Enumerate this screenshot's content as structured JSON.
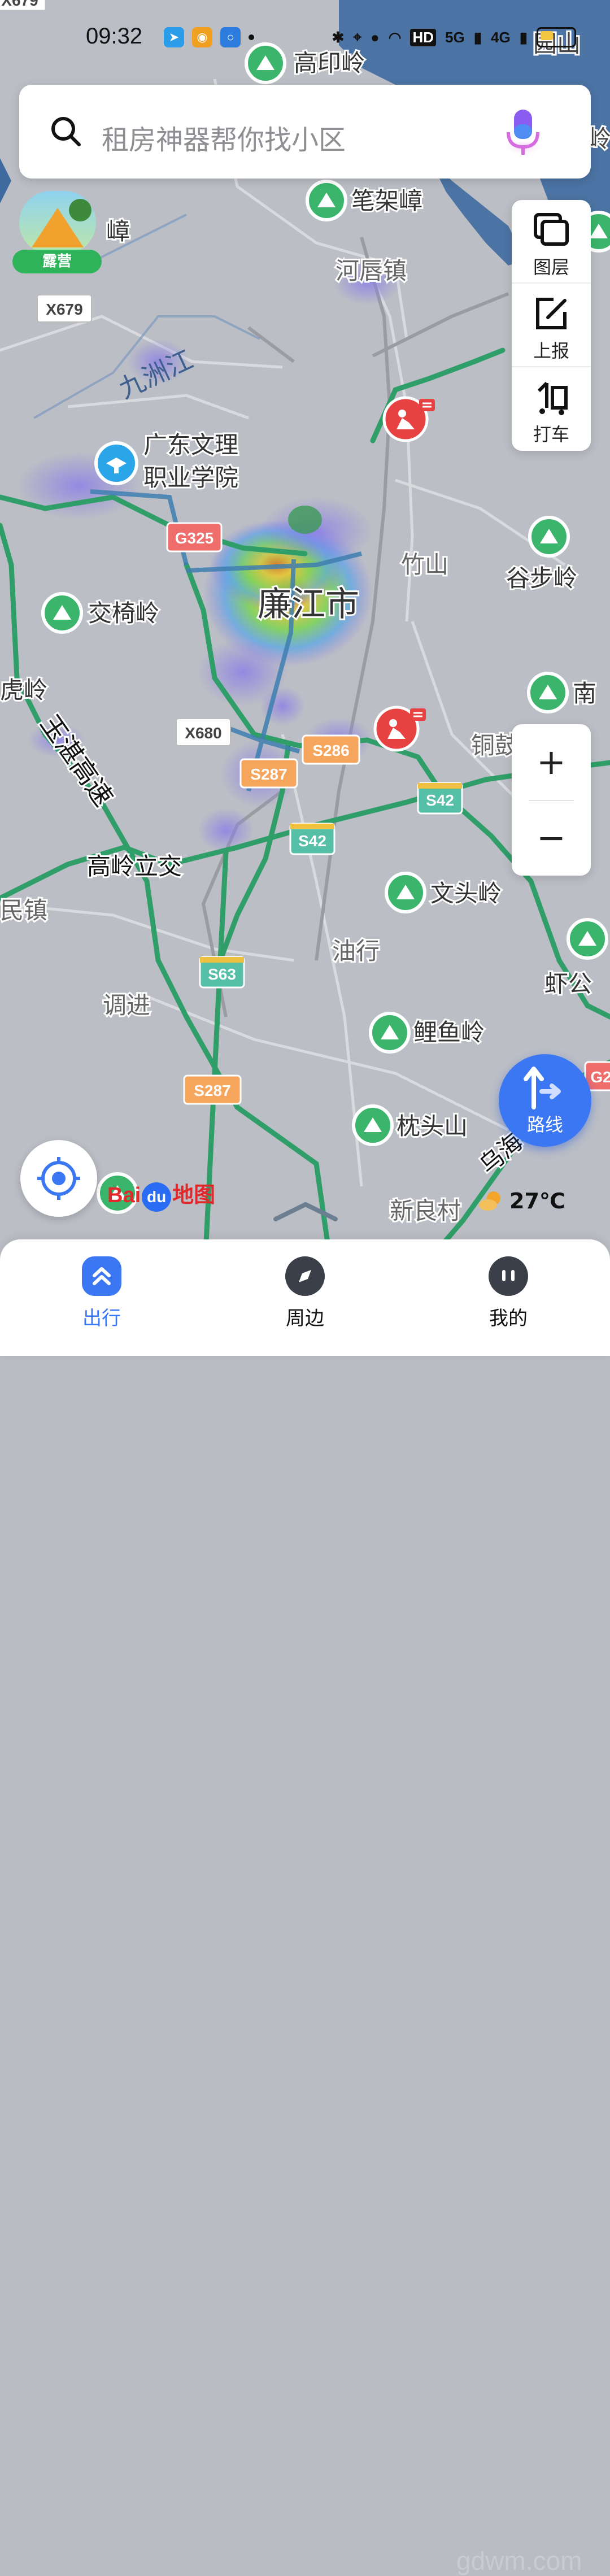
{
  "status_bar": {
    "time": "09:32",
    "hd": "HD",
    "net1": "5G",
    "net2": "4G"
  },
  "search": {
    "placeholder": "租房神器帮你找小区",
    "icon": "search-icon",
    "voice_icon": "microphone-icon"
  },
  "camp_badge": {
    "label": "露营"
  },
  "tools": [
    {
      "label": "图层",
      "icon": "layers-icon"
    },
    {
      "label": "上报",
      "icon": "edit-report-icon"
    },
    {
      "label": "打车",
      "icon": "taxi-icon"
    }
  ],
  "zoom": {
    "in": "+",
    "out": "−"
  },
  "route_button": {
    "label": "路线",
    "icon": "route-arrow-icon"
  },
  "logo": {
    "bai": "Bai",
    "du": "du",
    "ditu": "地图"
  },
  "weather": {
    "temp": "27℃",
    "icon": "partly-cloudy-icon"
  },
  "map_labels": {
    "x679_top": "X679",
    "gaoyinling": "高印岭",
    "bijiazhang": "笔架嶂",
    "hechunzhen": "河唇镇",
    "zhang_left": "嶂",
    "x679": "X679",
    "jiuzhoujiang": "九洲江",
    "gd_college_1": "广东文理",
    "gd_college_2": "职业学院",
    "g325": "G325",
    "zhushan": "竹山",
    "lianjiang": "廉江市",
    "gubuling": "谷步岭",
    "jiaoyiling": "交椅岭",
    "huling": "虎岭",
    "nan": "南",
    "x680": "X680",
    "s286": "S286",
    "s287_a": "S287",
    "tongling": "铜鼓",
    "s42_a": "S42",
    "s42_b": "S42",
    "expressway": "玉湛高速",
    "gaolinglijiao": "高岭立交",
    "minzhen": "民镇",
    "wentouling": "文头岭",
    "youhang": "油行",
    "xiagong": "虾公",
    "s63": "S63",
    "tiaojin": "调进",
    "liyuling": "鲤鱼岭",
    "s287_b": "S287",
    "zhentoushan": "枕头山",
    "xinliangcun": "新良村",
    "wuhai": "乌海",
    "g2": "G2",
    "gong_top": "园山",
    "ling_top_right": "岭"
  },
  "bottom_nav": [
    {
      "label": "出行",
      "active": true
    },
    {
      "label": "周边",
      "active": false
    },
    {
      "label": "我的",
      "active": false
    }
  ],
  "watermark": "gdwm.com"
}
